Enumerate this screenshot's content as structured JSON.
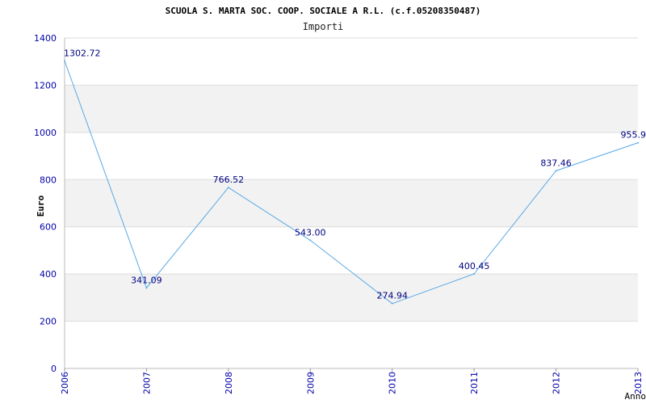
{
  "chart_data": {
    "type": "line",
    "title": "SCUOLA S. MARTA SOC. COOP. SOCIALE A R.L. (c.f.05208350487)",
    "subtitle": "Importi",
    "ylabel": "Euro",
    "xlabel": "Anno",
    "ylim": [
      0,
      1400
    ],
    "yticks": [
      0,
      200,
      400,
      600,
      800,
      1000,
      1200,
      1400
    ],
    "x": [
      "2006",
      "2007",
      "2008",
      "2009",
      "2010",
      "2011",
      "2012",
      "2013"
    ],
    "values": [
      1302.72,
      341.09,
      766.52,
      543.0,
      274.94,
      400.45,
      837.46,
      955.9
    ],
    "data_labels": [
      "1302.72",
      "341.09",
      "766.52",
      "543.00",
      "274.94",
      "400.45",
      "837.46",
      "955.9"
    ],
    "grid": "horizontal bands",
    "colors": {
      "line": "#5aaae6",
      "band": "#f2f2f2",
      "tick_text": "#0000aa",
      "label_text": "#000080"
    }
  }
}
